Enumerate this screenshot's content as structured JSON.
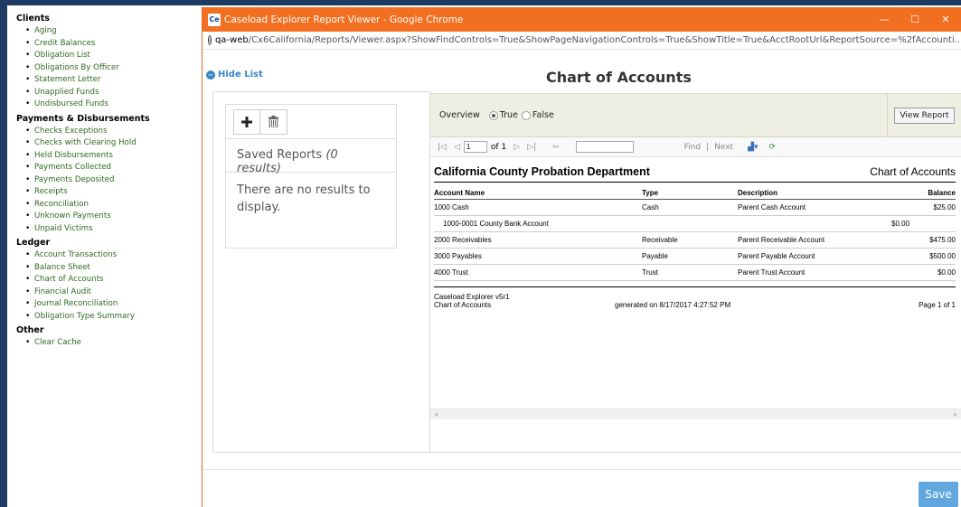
{
  "sidebar": {
    "sections": [
      {
        "title": "Clients",
        "items": [
          "Aging",
          "Credit Balances",
          "Obligation List",
          "Obligations By Officer",
          "Statement Letter",
          "Unapplied Funds",
          "Undisbursed Funds"
        ]
      },
      {
        "title": "Payments & Disbursements",
        "items": [
          "Checks Exceptions",
          "Checks with Clearing Hold",
          "Held Disbursements",
          "Payments Collected",
          "Payments Deposited",
          "Receipts",
          "Reconciliation",
          "Unknown Payments",
          "Unpaid Victims"
        ]
      },
      {
        "title": "Ledger",
        "items": [
          "Account Transactions",
          "Balance Sheet",
          "Chart of Accounts",
          "Financial Audit",
          "Journal Reconciliation",
          "Obligation Type Summary"
        ]
      },
      {
        "title": "Other",
        "items": [
          "Clear Cache"
        ]
      }
    ]
  },
  "window": {
    "badge": "Ce",
    "title": "Caseload Explorer Report Viewer - Google Chrome",
    "minimize": "—",
    "maximize": "☐",
    "close": "✕",
    "url_host": "qa-web",
    "url_path": "/Cx6California/Reports/Viewer.aspx?ShowFindControls=True&ShowPageNavigationControls=True&ShowTitle=True&AcctRootUrl&ReportSource=%2fAccounti..."
  },
  "page": {
    "hide_list": "Hide List",
    "title": "Chart of Accounts",
    "save": "Save"
  },
  "saved_reports": {
    "heading": "Saved Reports",
    "count": "(0 results)",
    "empty": "There are no results to display."
  },
  "viewer": {
    "param_label": "Overview",
    "opt_true": "True",
    "opt_false": "False",
    "view_report": "View Report",
    "page_value": "1",
    "of_pages": "of 1",
    "find": "Find",
    "next": "Next"
  },
  "report": {
    "org": "California County Probation Department",
    "name": "Chart of Accounts",
    "columns": [
      "Account Name",
      "Type",
      "Description",
      "Balance"
    ],
    "rows": [
      {
        "account": "1000 Cash",
        "type": "Cash",
        "description": "Parent Cash Account",
        "balance": "$25.00"
      },
      {
        "account": "1000-0001 County Bank Account",
        "type": "",
        "description": "",
        "balance": "$0.00"
      },
      {
        "account": "2000 Receivables",
        "type": "Receivable",
        "description": "Parent Receivable Account",
        "balance": "$475.00"
      },
      {
        "account": "3000 Payables",
        "type": "Payable",
        "description": "Parent Payable Account",
        "balance": "$500.00"
      },
      {
        "account": "4000 Trust",
        "type": "Trust",
        "description": "Parent Trust Account",
        "balance": "$0.00"
      }
    ],
    "footer_app": "Caseload Explorer v5r1",
    "footer_report": "Chart of Accounts",
    "generated": "generated on 8/17/2017 4:27:52 PM",
    "page_of": "Page 1 of 1"
  },
  "colors": {
    "titlebar": "#f26f21",
    "nav_link": "#2d6a1f",
    "accent": "#3a86c8",
    "save_button": "#60a7e0"
  }
}
